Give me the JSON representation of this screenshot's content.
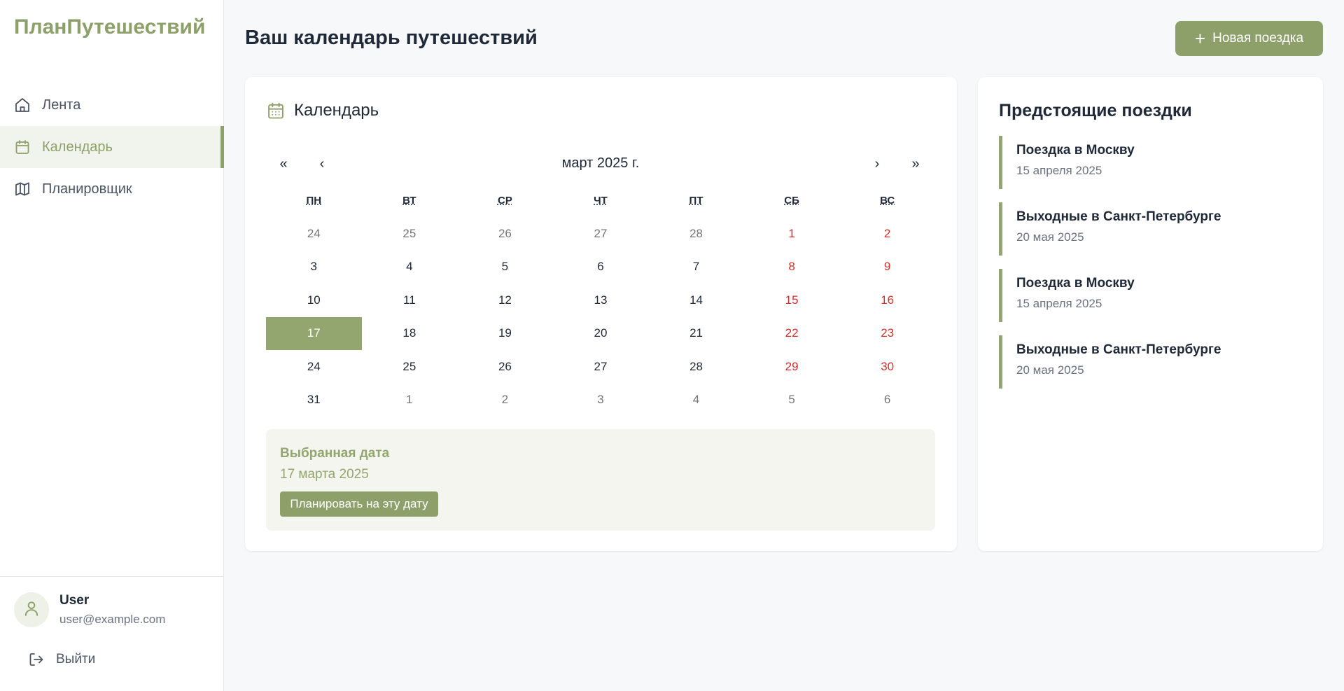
{
  "app": {
    "brand": "ПланПутешествий"
  },
  "sidebar": {
    "items": [
      {
        "label": "Лента",
        "icon": "home-icon"
      },
      {
        "label": "Календарь",
        "icon": "calendar-icon",
        "active": true
      },
      {
        "label": "Планировщик",
        "icon": "map-icon"
      }
    ],
    "user": {
      "name": "User",
      "email": "user@example.com",
      "icon": "user-icon"
    },
    "logout_label": "Выйти"
  },
  "header": {
    "title": "Ваш календарь путешествий",
    "new_trip_label": "Новая поездка"
  },
  "calendar": {
    "title": "Календарь",
    "month_label": "март 2025 г.",
    "nav": {
      "prev_year": "«",
      "prev_month": "‹",
      "next_month": "›",
      "next_year": "»"
    },
    "weekdays": [
      "ПН",
      "ВТ",
      "СР",
      "ЧТ",
      "ПТ",
      "СБ",
      "ВС"
    ],
    "weeks": [
      [
        "24",
        "25",
        "26",
        "27",
        "28",
        "1",
        "2"
      ],
      [
        "3",
        "4",
        "5",
        "6",
        "7",
        "8",
        "9"
      ],
      [
        "10",
        "11",
        "12",
        "13",
        "14",
        "15",
        "16"
      ],
      [
        "17",
        "18",
        "19",
        "20",
        "21",
        "22",
        "23"
      ],
      [
        "24",
        "25",
        "26",
        "27",
        "28",
        "29",
        "30"
      ],
      [
        "31",
        "1",
        "2",
        "3",
        "4",
        "5",
        "6"
      ]
    ],
    "selected_day": "17",
    "selected_panel": {
      "title": "Выбранная дата",
      "date": "17 марта 2025",
      "button_label": "Планировать на эту дату"
    }
  },
  "upcoming": {
    "title": "Предстоящие поездки",
    "trips": [
      {
        "name": "Поездка в Москву",
        "date": "15 апреля 2025"
      },
      {
        "name": "Выходные в Санкт-Петербурге",
        "date": "20 мая 2025"
      },
      {
        "name": "Поездка в Москву",
        "date": "15 апреля 2025"
      },
      {
        "name": "Выходные в Санкт-Петербурге",
        "date": "20 мая 2025"
      }
    ]
  },
  "colors": {
    "accent": "#8ea06a",
    "weekend": "#d32f2f",
    "muted": "#757575"
  }
}
